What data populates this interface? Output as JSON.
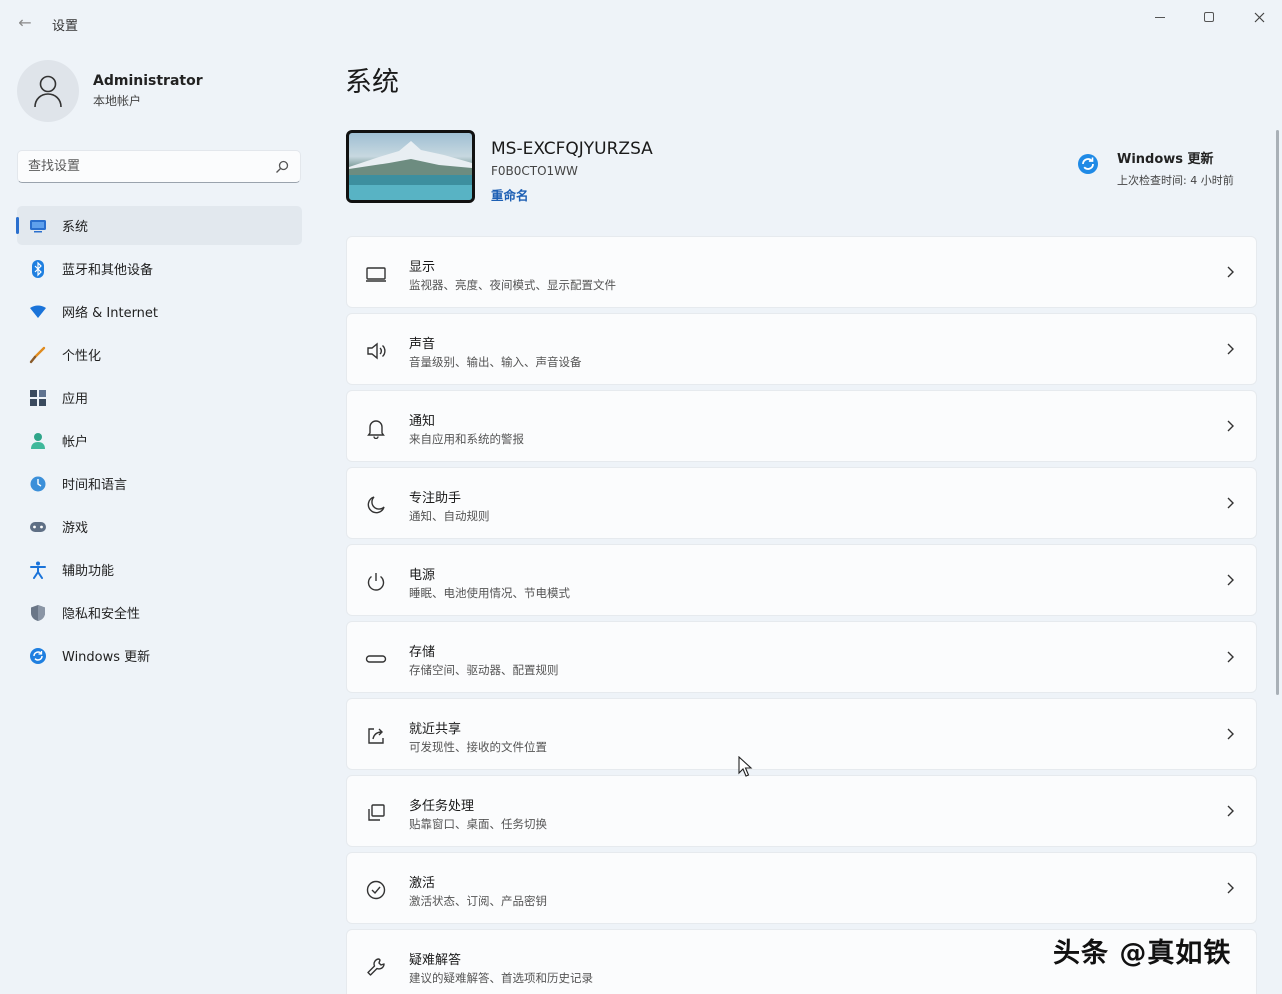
{
  "window": {
    "back_glyph": "←",
    "title": "设置",
    "controls": [
      "minimize",
      "maximize",
      "close"
    ]
  },
  "profile": {
    "name": "Administrator",
    "subtitle": "本地帐户"
  },
  "search": {
    "placeholder": "查找设置"
  },
  "sidebar": {
    "accent": "#2a6fce",
    "items": [
      {
        "label": "系统",
        "icon": "monitor-icon",
        "active": true
      },
      {
        "label": "蓝牙和其他设备",
        "icon": "bluetooth-icon"
      },
      {
        "label": "网络 & Internet",
        "icon": "wifi-icon"
      },
      {
        "label": "个性化",
        "icon": "brush-icon"
      },
      {
        "label": "应用",
        "icon": "apps-icon"
      },
      {
        "label": "帐户",
        "icon": "person-icon"
      },
      {
        "label": "时间和语言",
        "icon": "globe-clock-icon"
      },
      {
        "label": "游戏",
        "icon": "gamepad-icon"
      },
      {
        "label": "辅助功能",
        "icon": "accessibility-icon"
      },
      {
        "label": "隐私和安全性",
        "icon": "shield-icon"
      },
      {
        "label": "Windows 更新",
        "icon": "update-icon"
      }
    ]
  },
  "main": {
    "title": "系统",
    "device": {
      "name": "MS-EXCFQJYURZSA",
      "model": "F0B0CTO1WW",
      "rename": "重命名"
    },
    "windows_update": {
      "title": "Windows 更新",
      "subtitle": "上次检查时间: 4 小时前"
    },
    "rows": [
      {
        "title": "显示",
        "subtitle": "监视器、亮度、夜间模式、显示配置文件",
        "icon": "display-icon"
      },
      {
        "title": "声音",
        "subtitle": "音量级别、输出、输入、声音设备",
        "icon": "speaker-icon"
      },
      {
        "title": "通知",
        "subtitle": "来自应用和系统的警报",
        "icon": "bell-icon"
      },
      {
        "title": "专注助手",
        "subtitle": "通知、自动规则",
        "icon": "moon-icon"
      },
      {
        "title": "电源",
        "subtitle": "睡眠、电池使用情况、节电模式",
        "icon": "power-icon"
      },
      {
        "title": "存储",
        "subtitle": "存储空间、驱动器、配置规则",
        "icon": "storage-icon"
      },
      {
        "title": "就近共享",
        "subtitle": "可发现性、接收的文件位置",
        "icon": "share-icon"
      },
      {
        "title": "多任务处理",
        "subtitle": "贴靠窗口、桌面、任务切换",
        "icon": "multitask-icon"
      },
      {
        "title": "激活",
        "subtitle": "激活状态、订阅、产品密钥",
        "icon": "check-circle-icon"
      },
      {
        "title": "疑难解答",
        "subtitle": "建议的疑难解答、首选项和历史记录",
        "icon": "wrench-icon"
      }
    ]
  },
  "watermark": "头条 @真如铁"
}
